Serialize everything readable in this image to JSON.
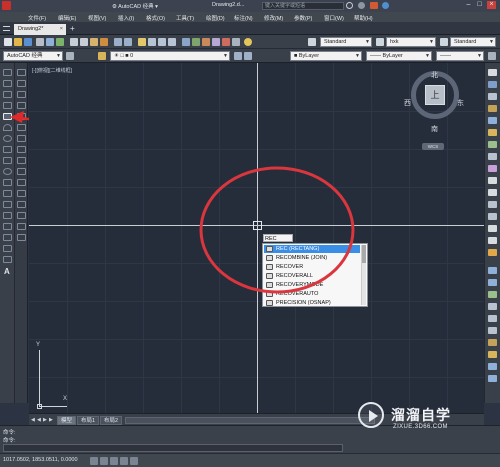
{
  "app": {
    "workspace": "AutoCAD 经典",
    "file_title": "Drawing2.d...",
    "search_placeholder": "键入关键字或短语"
  },
  "menu": [
    "文件(F)",
    "编辑(E)",
    "视图(V)",
    "插入(I)",
    "格式(O)",
    "工具(T)",
    "绘图(D)",
    "标注(N)",
    "修改(M)",
    "参数(P)",
    "窗口(W)",
    "帮助(H)"
  ],
  "document_tab": {
    "label": "Drawing2*",
    "close": "×"
  },
  "toolbar": {
    "workspace_combo": "AutoCAD 经典",
    "text_style": "Standard",
    "dim_style": "Standard",
    "layer": "hxk",
    "table_style": "Standard",
    "color": "ByLayer",
    "linetype": "ByLayer",
    "lineweight": "ByLayer"
  },
  "viewport_label": "[-][俯视][二维线框]",
  "viewcube": {
    "north": "北",
    "south": "南",
    "east": "东",
    "west": "西",
    "face": "上",
    "wcs": "WCS"
  },
  "command_input": "REC",
  "autocomplete": [
    "REC (RECTANG)",
    "RECOMBINE (JOIN)",
    "RECOVER",
    "RECOVERALL",
    "RECOVERYMODE",
    "RECOVERAUTO",
    "PRECISION (OSNAP)"
  ],
  "ucs": {
    "x": "X",
    "y": "Y"
  },
  "layout_tabs": [
    "模型",
    "布局1",
    "布局2"
  ],
  "command_history": [
    "命令:",
    "命令:"
  ],
  "status_coords": "1017.0502, 1853.0511, 0.0000",
  "watermark": {
    "title": "溜溜自学",
    "url": "ZIXUE.3D66.COM"
  },
  "colors": {
    "canvas": "#252c3a",
    "highlight": "#3a8ee6",
    "ring": "#d9363e",
    "arrow": "#e02a2a"
  }
}
